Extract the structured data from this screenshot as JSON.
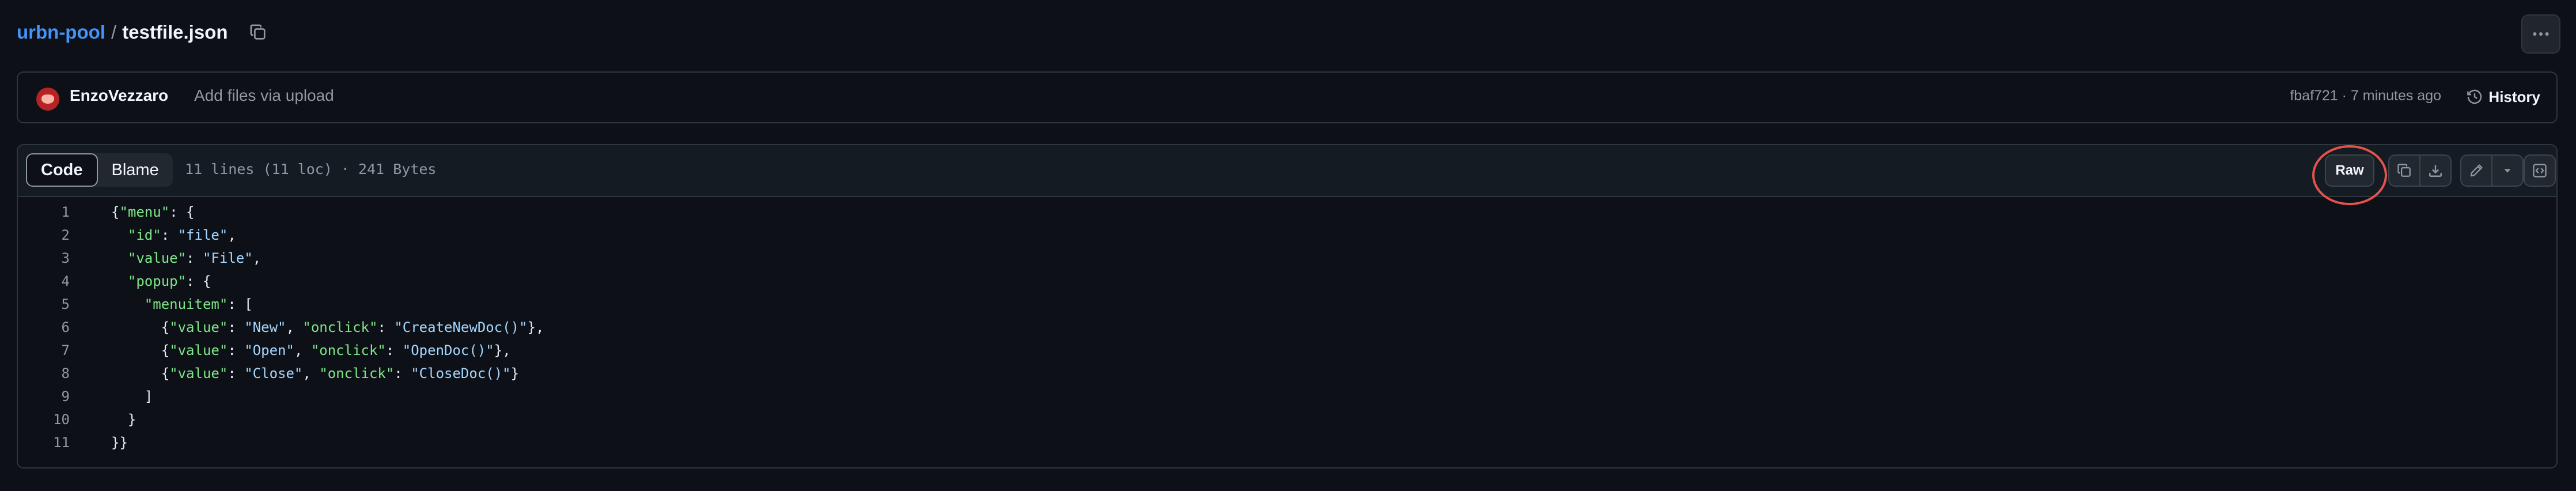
{
  "breadcrumb": {
    "repo": "urbn-pool",
    "separator": "/",
    "file": "testfile.json"
  },
  "commit": {
    "author": "EnzoVezzaro",
    "message": "Add files via upload",
    "meta": "fbaf721 · 7 minutes ago",
    "history_label": "History"
  },
  "viewer": {
    "tabs": [
      {
        "label": "Code",
        "active": true
      },
      {
        "label": "Blame",
        "active": false
      }
    ],
    "file_info": "11 lines (11 loc) · 241 Bytes",
    "raw_label": "Raw"
  },
  "code": {
    "line_numbers": [
      "1",
      "2",
      "3",
      "4",
      "5",
      "6",
      "7",
      "8",
      "9",
      "10",
      "11"
    ],
    "tokens": {
      "l1_key": "\"menu\"",
      "l2_key": "\"id\"",
      "l2_val": "\"file\"",
      "l3_key": "\"value\"",
      "l3_val": "\"File\"",
      "l4_key": "\"popup\"",
      "l5_key": "\"menuitem\"",
      "l6_k1": "\"value\"",
      "l6_v1": "\"New\"",
      "l6_k2": "\"onclick\"",
      "l6_v2": "\"CreateNewDoc()\"",
      "l7_k1": "\"value\"",
      "l7_v1": "\"Open\"",
      "l7_k2": "\"onclick\"",
      "l7_v2": "\"OpenDoc()\"",
      "l8_k1": "\"value\"",
      "l8_v1": "\"Close\"",
      "l8_k2": "\"onclick\"",
      "l8_v2": "\"CloseDoc()\""
    }
  },
  "colors": {
    "accent": "#4493f8",
    "highlight_ring": "#e5534b",
    "json_key": "#7ee787",
    "json_string": "#a5d6ff"
  },
  "icons": [
    "copy-icon",
    "kebab-icon",
    "clock-icon",
    "download-icon",
    "pencil-icon",
    "caret-down-icon",
    "code-square-icon"
  ]
}
